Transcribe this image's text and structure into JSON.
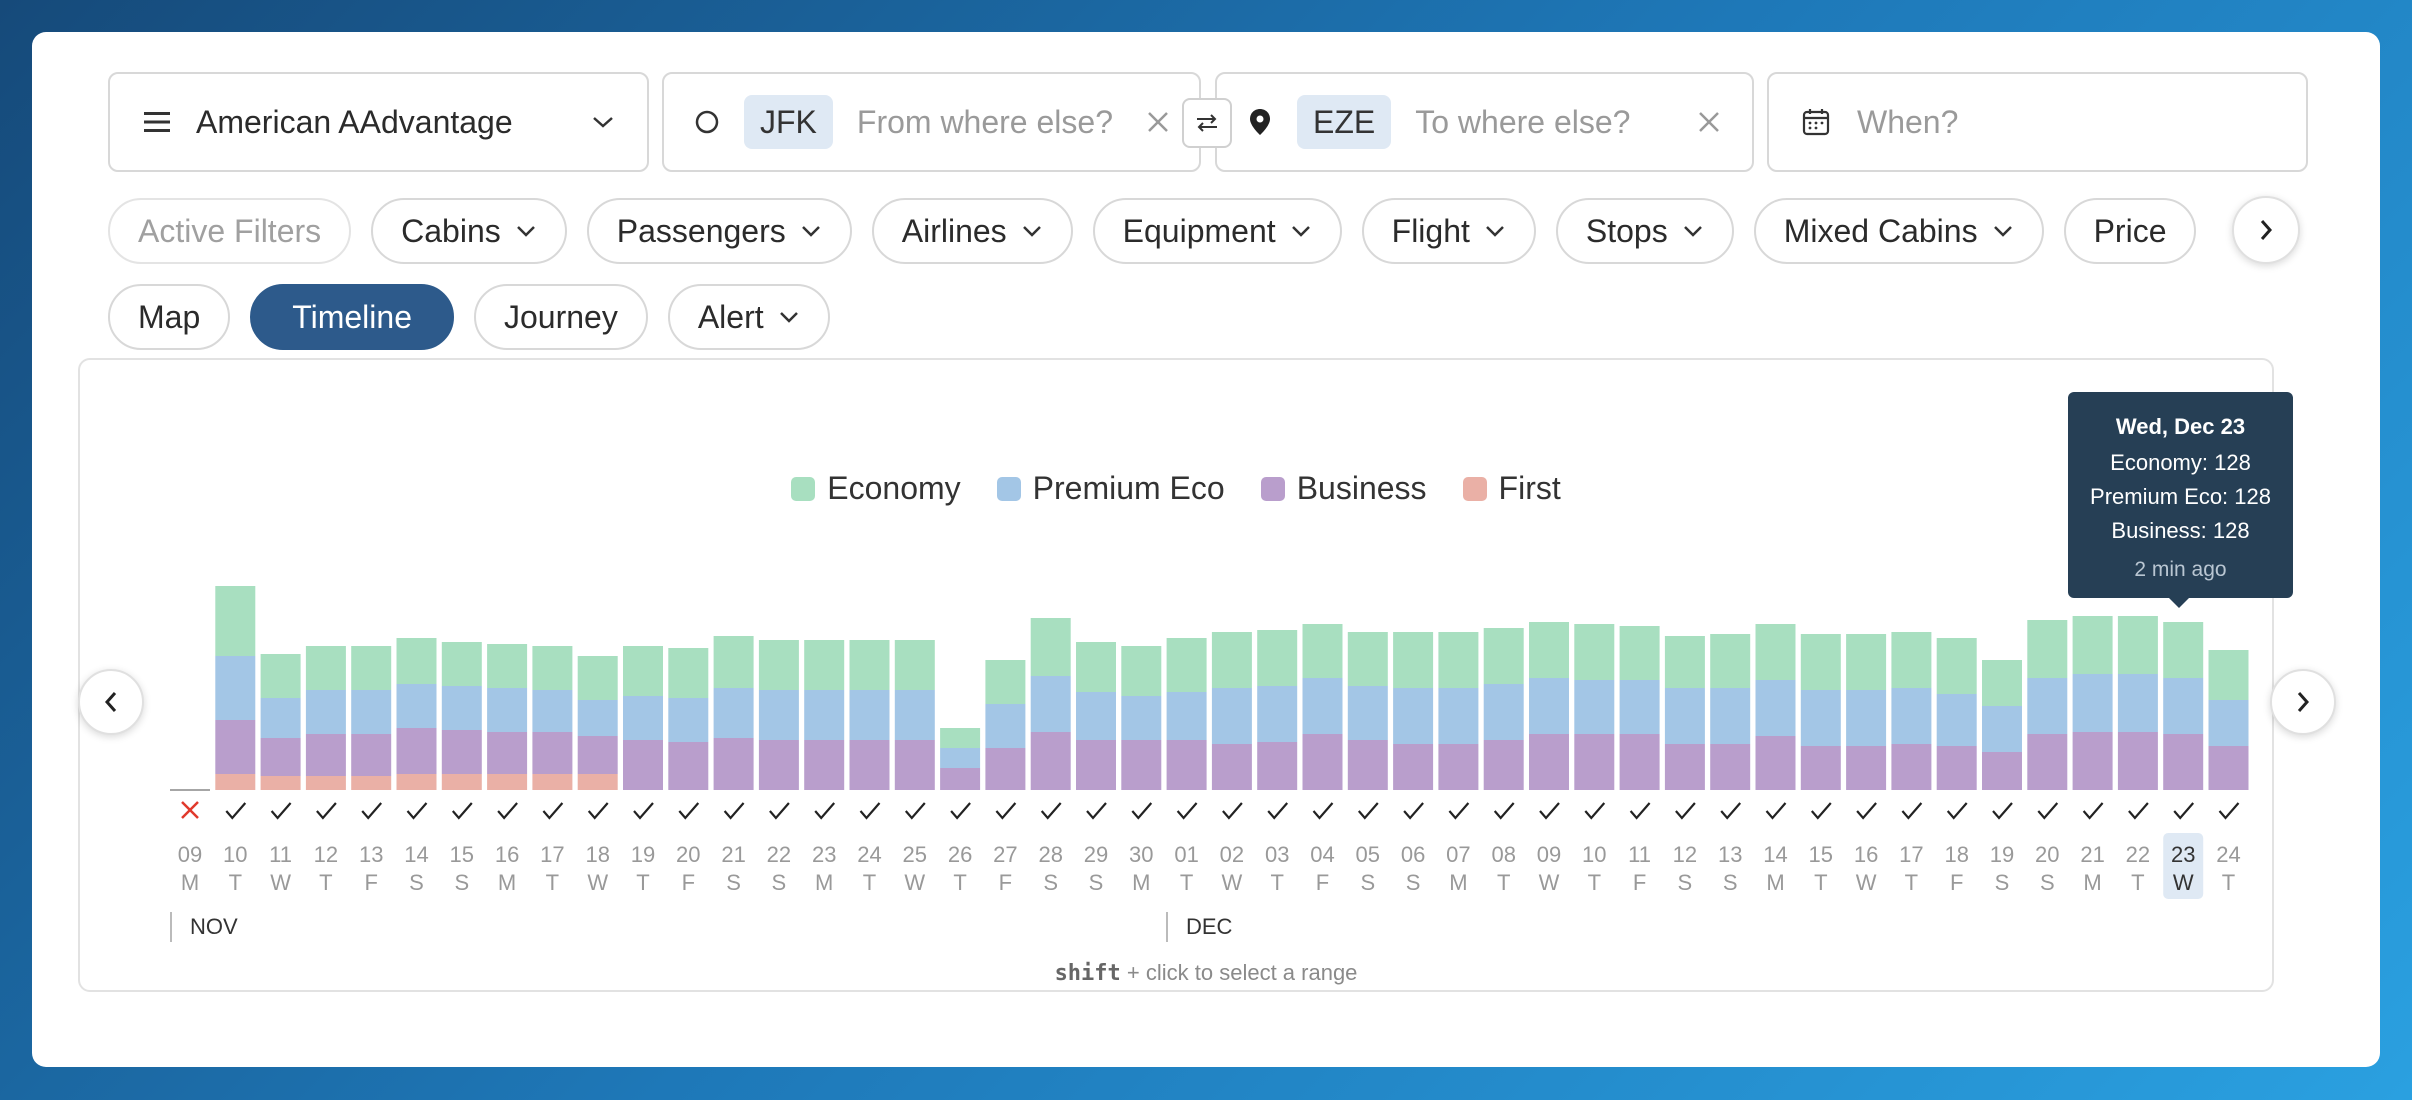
{
  "header": {
    "program": "American AAdvantage",
    "origin_code": "JFK",
    "origin_placeholder": "From where else?",
    "dest_code": "EZE",
    "dest_placeholder": "To where else?",
    "date_placeholder": "When?"
  },
  "filters": [
    "Active Filters",
    "Cabins",
    "Passengers",
    "Airlines",
    "Equipment",
    "Flight",
    "Stops",
    "Mixed Cabins",
    "Price"
  ],
  "views": {
    "map": "Map",
    "timeline": "Timeline",
    "journey": "Journey",
    "alert": "Alert",
    "active": "Timeline"
  },
  "tooltip": {
    "title": "Wed, Dec 23",
    "economy": "Economy: 128",
    "premium": "Premium Eco: 128",
    "business": "Business: 128",
    "ago": "2 min ago"
  },
  "months": [
    "NOV",
    "DEC"
  ],
  "hint": {
    "key": "shift",
    "text": " + click to select a range"
  },
  "colors": {
    "economy": "#a8dfc0",
    "premium": "#a3c6e6",
    "business": "#b99ecc",
    "first": "#eab0a6",
    "accent": "#2d5a8b"
  },
  "chart_data": {
    "type": "bar",
    "stacked": true,
    "legend": [
      "Economy",
      "Premium Eco",
      "Business",
      "First"
    ],
    "legend_position": "top-center",
    "days": [
      "09",
      "10",
      "11",
      "12",
      "13",
      "14",
      "15",
      "16",
      "17",
      "18",
      "19",
      "20",
      "21",
      "22",
      "23",
      "24",
      "25",
      "26",
      "27",
      "28",
      "29",
      "30",
      "01",
      "02",
      "03",
      "04",
      "05",
      "06",
      "07",
      "08",
      "09",
      "10",
      "11",
      "12",
      "13",
      "14",
      "15",
      "16",
      "17",
      "18",
      "19",
      "20",
      "21",
      "22",
      "23",
      "24"
    ],
    "weekdays": [
      "M",
      "T",
      "W",
      "T",
      "F",
      "S",
      "S",
      "M",
      "T",
      "W",
      "T",
      "F",
      "S",
      "S",
      "M",
      "T",
      "W",
      "T",
      "F",
      "S",
      "S",
      "M",
      "T",
      "W",
      "T",
      "F",
      "S",
      "S",
      "M",
      "T",
      "W",
      "T",
      "F",
      "S",
      "S",
      "M",
      "T",
      "W",
      "T",
      "F",
      "S",
      "S",
      "M",
      "T",
      "W",
      "T"
    ],
    "available": [
      false,
      true,
      true,
      true,
      true,
      true,
      true,
      true,
      true,
      true,
      true,
      true,
      true,
      true,
      true,
      true,
      true,
      true,
      true,
      true,
      true,
      true,
      true,
      true,
      true,
      true,
      true,
      true,
      true,
      true,
      true,
      true,
      true,
      true,
      true,
      true,
      true,
      true,
      true,
      true,
      true,
      true,
      true,
      true,
      true,
      true
    ],
    "selected_index": 44,
    "series": [
      {
        "name": "Economy",
        "values": [
          0,
          70,
          44,
          44,
          44,
          46,
          44,
          44,
          44,
          44,
          50,
          50,
          52,
          50,
          50,
          50,
          50,
          20,
          44,
          58,
          50,
          50,
          54,
          56,
          56,
          54,
          54,
          56,
          56,
          56,
          56,
          56,
          54,
          52,
          54,
          56,
          56,
          56,
          56,
          56,
          46,
          58,
          58,
          58,
          56,
          50
        ]
      },
      {
        "name": "Premium Eco",
        "values": [
          0,
          64,
          40,
          44,
          44,
          44,
          44,
          44,
          42,
          36,
          44,
          44,
          50,
          50,
          50,
          50,
          50,
          20,
          44,
          56,
          48,
          44,
          48,
          56,
          56,
          56,
          54,
          56,
          56,
          56,
          56,
          54,
          54,
          56,
          56,
          56,
          56,
          56,
          56,
          52,
          46,
          56,
          58,
          58,
          56,
          46
        ]
      },
      {
        "name": "Business",
        "values": [
          0,
          54,
          38,
          42,
          42,
          46,
          44,
          42,
          42,
          38,
          50,
          48,
          52,
          50,
          50,
          50,
          50,
          22,
          42,
          58,
          50,
          50,
          50,
          46,
          48,
          56,
          50,
          46,
          46,
          50,
          56,
          56,
          56,
          46,
          46,
          54,
          44,
          44,
          46,
          44,
          38,
          56,
          58,
          58,
          56,
          44
        ]
      },
      {
        "name": "First",
        "values": [
          0,
          16,
          14,
          14,
          14,
          16,
          16,
          16,
          16,
          16,
          0,
          0,
          0,
          0,
          0,
          0,
          0,
          0,
          0,
          0,
          0,
          0,
          0,
          0,
          0,
          0,
          0,
          0,
          0,
          0,
          0,
          0,
          0,
          0,
          0,
          0,
          0,
          0,
          0,
          0,
          0,
          0,
          0,
          0,
          0,
          0
        ]
      }
    ]
  }
}
